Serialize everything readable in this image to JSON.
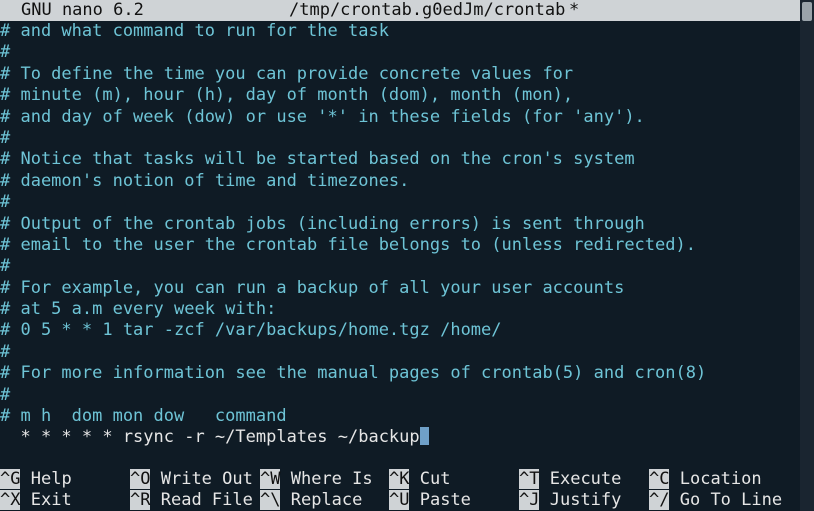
{
  "title_bar": {
    "app": "GNU nano 6.2",
    "filename": "/tmp/crontab.g0edJm/crontab",
    "modified_marker": "*"
  },
  "editor_lines": [
    {
      "text": "# and what command to run for the task",
      "type": "comment"
    },
    {
      "text": "#",
      "type": "comment"
    },
    {
      "text": "# To define the time you can provide concrete values for",
      "type": "comment"
    },
    {
      "text": "# minute (m), hour (h), day of month (dom), month (mon),",
      "type": "comment"
    },
    {
      "text": "# and day of week (dow) or use '*' in these fields (for 'any').",
      "type": "comment"
    },
    {
      "text": "#",
      "type": "comment"
    },
    {
      "text": "# Notice that tasks will be started based on the cron's system",
      "type": "comment"
    },
    {
      "text": "# daemon's notion of time and timezones.",
      "type": "comment"
    },
    {
      "text": "#",
      "type": "comment"
    },
    {
      "text": "# Output of the crontab jobs (including errors) is sent through",
      "type": "comment"
    },
    {
      "text": "# email to the user the crontab file belongs to (unless redirected).",
      "type": "comment"
    },
    {
      "text": "#",
      "type": "comment"
    },
    {
      "text": "# For example, you can run a backup of all your user accounts",
      "type": "comment"
    },
    {
      "text": "# at 5 a.m every week with:",
      "type": "comment"
    },
    {
      "text": "# 0 5 * * 1 tar -zcf /var/backups/home.tgz /home/",
      "type": "comment"
    },
    {
      "text": "#",
      "type": "comment"
    },
    {
      "text": "# For more information see the manual pages of crontab(5) and cron(8)",
      "type": "comment"
    },
    {
      "text": "#",
      "type": "comment"
    },
    {
      "text": "# m h  dom mon dow   command",
      "type": "comment"
    },
    {
      "text": "  * * * * * rsync -r ~/Templates ~/backup",
      "type": "code",
      "cursor_at_end": true
    }
  ],
  "shortcuts": [
    [
      {
        "key": "^G",
        "label": "Help"
      },
      {
        "key": "^O",
        "label": "Write Out"
      },
      {
        "key": "^W",
        "label": "Where Is"
      },
      {
        "key": "^K",
        "label": "Cut"
      },
      {
        "key": "^T",
        "label": "Execute"
      },
      {
        "key": "^C",
        "label": "Location"
      }
    ],
    [
      {
        "key": "^X",
        "label": "Exit"
      },
      {
        "key": "^R",
        "label": "Read File"
      },
      {
        "key": "^\\",
        "label": "Replace"
      },
      {
        "key": "^U",
        "label": "Paste"
      },
      {
        "key": "^J",
        "label": "Justify"
      },
      {
        "key": "^/",
        "label": "Go To Line"
      }
    ]
  ],
  "colors": {
    "background": "#0f1b25",
    "comment": "#6ec4d6",
    "code": "#e6e6e6",
    "bar": "#cfd3d6",
    "cursor": "#6fa0c8"
  }
}
